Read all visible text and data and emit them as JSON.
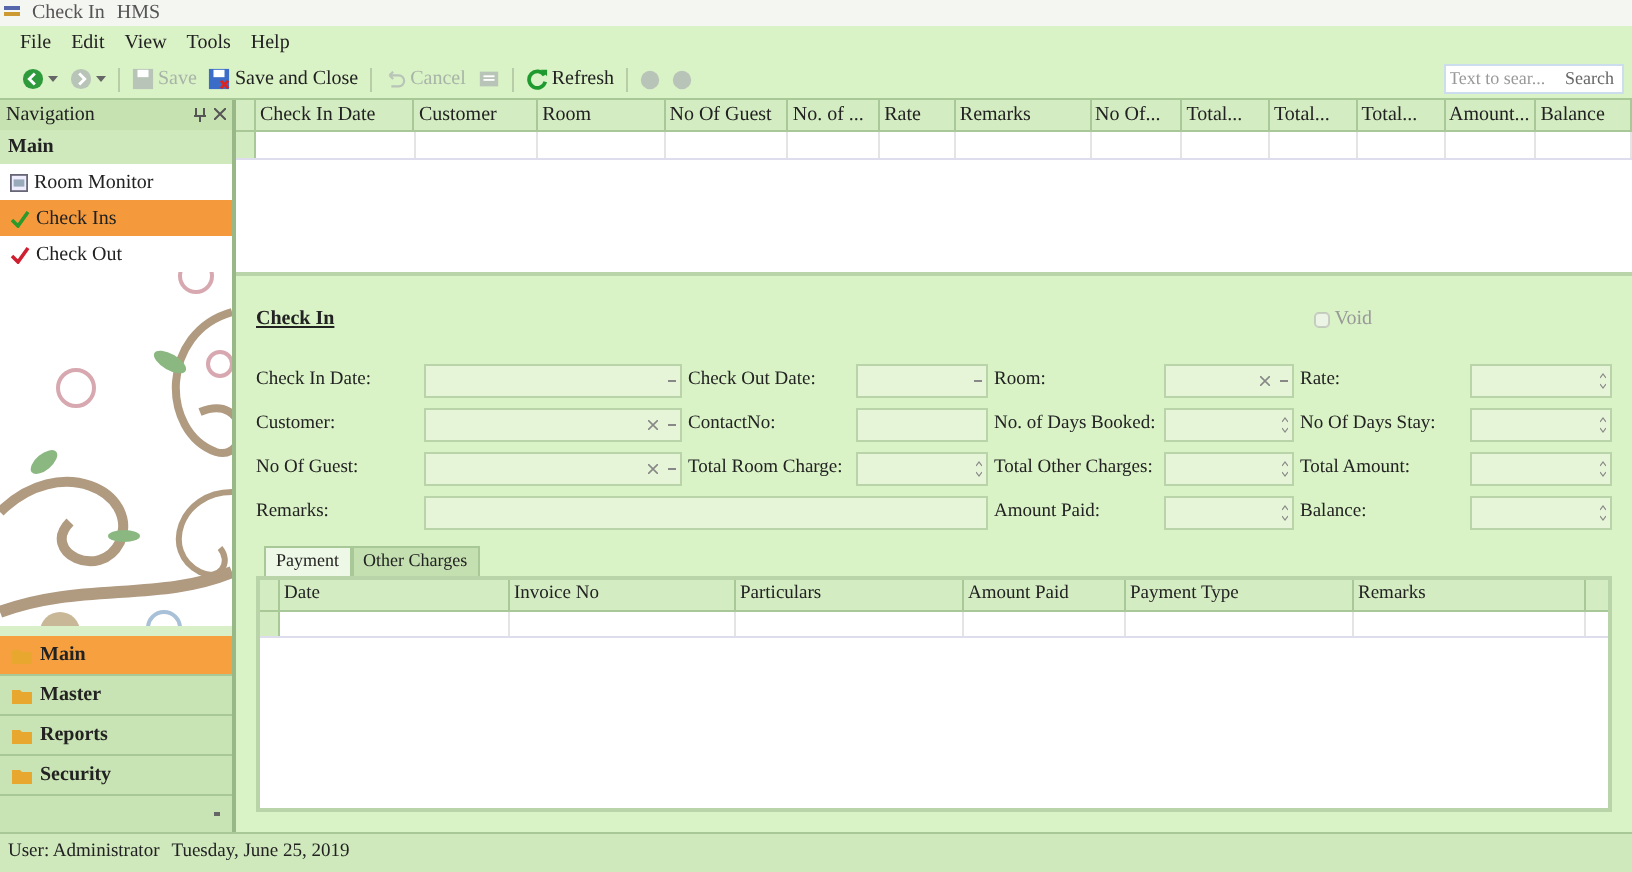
{
  "window": {
    "title": "Check In",
    "app": "HMS"
  },
  "menu": [
    "File",
    "Edit",
    "View",
    "Tools",
    "Help"
  ],
  "toolbar": [
    {
      "kind": "back",
      "disabled": false
    },
    {
      "kind": "forward",
      "disabled": true
    },
    {
      "kind": "save",
      "label": "Save",
      "disabled": true
    },
    {
      "kind": "save-close",
      "label": "Save and Close",
      "disabled": false
    },
    {
      "kind": "cancel",
      "label": "Cancel",
      "disabled": true
    },
    {
      "kind": "print",
      "disabled": true
    },
    {
      "kind": "refresh",
      "label": "Refresh",
      "disabled": false
    },
    {
      "kind": "info",
      "disabled": true
    },
    {
      "kind": "help",
      "disabled": true
    }
  ],
  "search": {
    "placeholder": "Text to sear...",
    "button": "Search"
  },
  "navigation": {
    "title": "Navigation",
    "group": "Main",
    "items": [
      {
        "label": "Room Monitor",
        "selected": false
      },
      {
        "label": "Check Ins",
        "selected": true
      },
      {
        "label": "Check Out",
        "selected": false
      }
    ],
    "groups": [
      {
        "label": "Main",
        "selected": true
      },
      {
        "label": "Master",
        "selected": false
      },
      {
        "label": "Reports",
        "selected": false
      },
      {
        "label": "Security",
        "selected": false
      }
    ]
  },
  "grid": {
    "columns": [
      "Check In Date",
      "Customer",
      "Room",
      "No Of Guest",
      "No. of ...",
      "Rate",
      "Remarks",
      "No Of...",
      "Total...",
      "Total...",
      "Total...",
      "Amount...",
      "Balance"
    ]
  },
  "form": {
    "title": "Check In",
    "void": {
      "label": "Void",
      "checked": false,
      "disabled": true
    },
    "fields": [
      {
        "label": "Check In Date:",
        "kind": "date"
      },
      {
        "label": "Check Out Date:",
        "kind": "date"
      },
      {
        "label": "Room:",
        "kind": "combo"
      },
      {
        "label": "Rate:",
        "kind": "spin"
      },
      {
        "label": "Customer:",
        "kind": "combo"
      },
      {
        "label": "ContactNo:",
        "kind": "text"
      },
      {
        "label": "No. of Days Booked:",
        "kind": "spin"
      },
      {
        "label": "No Of Days Stay:",
        "kind": "spin"
      },
      {
        "label": "No Of Guest:",
        "kind": "combo"
      },
      {
        "label": "Total Room Charge:",
        "kind": "spin"
      },
      {
        "label": "Total Other Charges:",
        "kind": "spin"
      },
      {
        "label": "Total Amount:",
        "kind": "spin"
      },
      {
        "label": "Remarks:",
        "kind": "memo"
      },
      {
        "label": "Amount Paid:",
        "kind": "spin"
      },
      {
        "label": "Balance:",
        "kind": "spin"
      }
    ],
    "tabs": [
      {
        "label": "Payment",
        "selected": true
      },
      {
        "label": "Other Charges",
        "selected": false
      }
    ],
    "payment_columns": [
      "Date",
      "Invoice No",
      "Particulars",
      "Amount Paid",
      "Payment Type",
      "Remarks"
    ]
  },
  "status_bar": {
    "user": "User: Administrator",
    "date": "Tuesday, June 25, 2019"
  }
}
